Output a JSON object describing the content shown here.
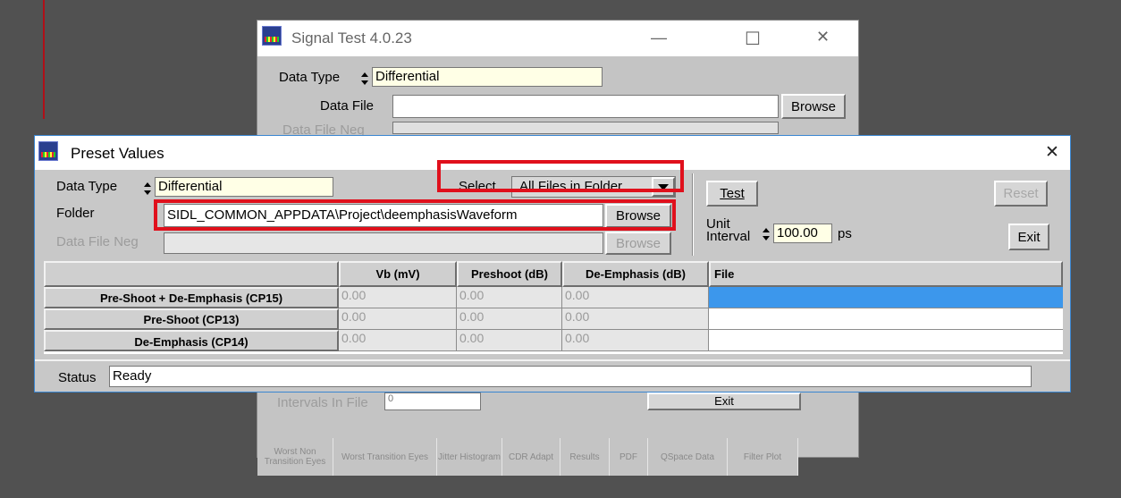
{
  "back_window": {
    "title": "Signal Test 4.0.23",
    "data_type_label": "Data Type",
    "data_type_value": "Differential",
    "data_file_label": "Data File",
    "browse_label": "Browse",
    "data_file_neg_label": "Data File Neg",
    "intervals_label": "Intervals In File",
    "intervals_value": "0",
    "exit_label": "Exit",
    "tabs": [
      {
        "label": "Worst Non Transition Eyes"
      },
      {
        "label": "Worst Transition Eyes"
      },
      {
        "label": "Jitter Histogram"
      },
      {
        "label": "CDR Adapt"
      },
      {
        "label": "Results"
      },
      {
        "label": "PDF"
      },
      {
        "label": "QSpace Data"
      },
      {
        "label": "Filter Plot"
      }
    ]
  },
  "window_controls": {
    "minimize": "—",
    "maximize": "☐",
    "close": "✕"
  },
  "preset": {
    "title": "Preset Values",
    "close": "✕",
    "data_type_label": "Data Type",
    "data_type_value": "Differential",
    "select_label": "Select",
    "select_value": "All Files in Folder",
    "folder_label": "Folder",
    "folder_value": "SIDL_COMMON_APPDATA\\Project\\deemphasisWaveform",
    "browse_label": "Browse",
    "data_file_neg_label": "Data File Neg",
    "browse_neg_label": "Browse",
    "test_label": "Test",
    "reset_label": "Reset",
    "exit_label": "Exit",
    "unit_label": "Unit",
    "interval_label": "Interval",
    "unit_interval_value": "100.00",
    "unit_interval_unit": "ps",
    "status_label": "Status",
    "status_value": "Ready",
    "table": {
      "columns": [
        "Vb (mV)",
        "Preshoot (dB)",
        "De-Emphasis (dB)",
        "File"
      ],
      "rows": [
        {
          "name": "Pre-Shoot + De-Emphasis (CP15)",
          "vb": "0.00",
          "preshoot": "0.00",
          "deemph": "0.00",
          "file": ""
        },
        {
          "name": "Pre-Shoot (CP13)",
          "vb": "0.00",
          "preshoot": "0.00",
          "deemph": "0.00",
          "file": ""
        },
        {
          "name": "De-Emphasis (CP14)",
          "vb": "0.00",
          "preshoot": "0.00",
          "deemph": "0.00",
          "file": ""
        }
      ]
    }
  },
  "colors": {
    "highlight": "#e0101c",
    "selection": "#3c97ec",
    "accent_border": "#3a86d1"
  }
}
